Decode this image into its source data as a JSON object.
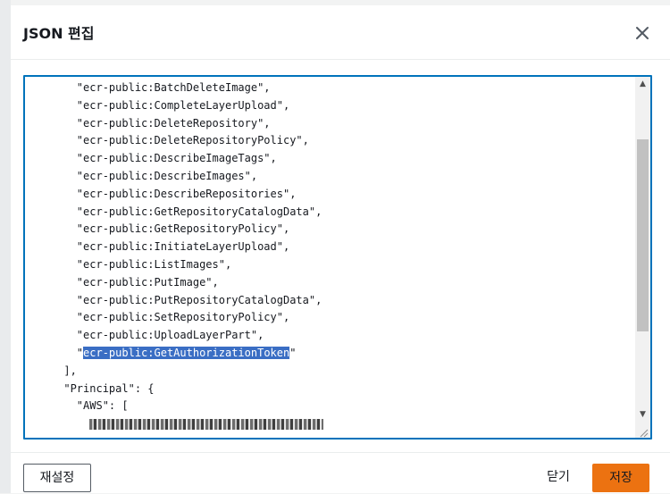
{
  "modal": {
    "title": "JSON 편집",
    "close_icon": "close-icon"
  },
  "editor": {
    "lines": [
      {
        "indent": "        ",
        "text": "\"ecr-public:BatchDeleteImage\","
      },
      {
        "indent": "        ",
        "text": "\"ecr-public:CompleteLayerUpload\","
      },
      {
        "indent": "        ",
        "text": "\"ecr-public:DeleteRepository\","
      },
      {
        "indent": "        ",
        "text": "\"ecr-public:DeleteRepositoryPolicy\","
      },
      {
        "indent": "        ",
        "text": "\"ecr-public:DescribeImageTags\","
      },
      {
        "indent": "        ",
        "text": "\"ecr-public:DescribeImages\","
      },
      {
        "indent": "        ",
        "text": "\"ecr-public:DescribeRepositories\","
      },
      {
        "indent": "        ",
        "text": "\"ecr-public:GetRepositoryCatalogData\","
      },
      {
        "indent": "        ",
        "text": "\"ecr-public:GetRepositoryPolicy\","
      },
      {
        "indent": "        ",
        "text": "\"ecr-public:InitiateLayerUpload\","
      },
      {
        "indent": "        ",
        "text": "\"ecr-public:ListImages\","
      },
      {
        "indent": "        ",
        "text": "\"ecr-public:PutImage\","
      },
      {
        "indent": "        ",
        "text": "\"ecr-public:PutRepositoryCatalogData\","
      },
      {
        "indent": "        ",
        "text": "\"ecr-public:SetRepositoryPolicy\","
      },
      {
        "indent": "        ",
        "text": "\"ecr-public:UploadLayerPart\","
      },
      {
        "indent": "        ",
        "pre": "\"",
        "selected": "ecr-public:GetAuthorizationToken",
        "post": "\""
      },
      {
        "indent": "      ",
        "text": "],"
      },
      {
        "indent": "      ",
        "text": "\"Principal\": {"
      },
      {
        "indent": "        ",
        "text": "\"AWS\": ["
      },
      {
        "indent": "          ",
        "redacted": true
      }
    ],
    "scroll_up_icon": "scroll-up-arrow-icon",
    "scroll_down_icon": "scroll-down-arrow-icon",
    "resize_icon": "resize-grip-icon"
  },
  "footer": {
    "reset_label": "재설정",
    "close_label": "닫기",
    "save_label": "저장"
  },
  "colors": {
    "focus_border": "#0073bb",
    "primary_button": "#ec7211",
    "selection": "#3a6ec4"
  }
}
